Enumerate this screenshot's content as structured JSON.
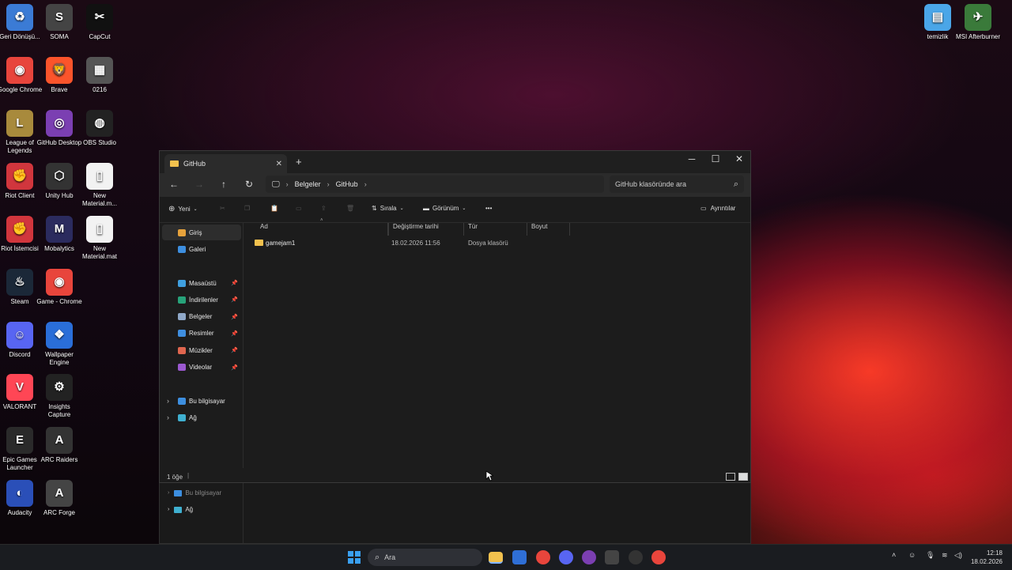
{
  "desktop": {
    "icons": [
      {
        "label": "Geri Dönüşü...",
        "glyph": "♻",
        "color": "#3b7bd5"
      },
      {
        "label": "SOMA",
        "glyph": "S",
        "color": "#444444"
      },
      {
        "label": "CapCut",
        "glyph": "✂",
        "color": "#111111"
      },
      {
        "label": "Google Chrome",
        "glyph": "◉",
        "color": "#e8453c"
      },
      {
        "label": "Brave",
        "glyph": "🦁",
        "color": "#fb542b"
      },
      {
        "label": "0216",
        "glyph": "▦",
        "color": "#555555"
      },
      {
        "label": "League of Legends",
        "glyph": "L",
        "color": "#a88a3c"
      },
      {
        "label": "GitHub Desktop",
        "glyph": "◎",
        "color": "#7b3fb2"
      },
      {
        "label": "OBS Studio",
        "glyph": "◍",
        "color": "#222222"
      },
      {
        "label": "Riot Client",
        "glyph": "✊",
        "color": "#d1363d"
      },
      {
        "label": "Unity Hub",
        "glyph": "⬡",
        "color": "#333333"
      },
      {
        "label": "New Material.m...",
        "glyph": "▯",
        "color": "#f2f2f2"
      },
      {
        "label": "Riot İstemcisi",
        "glyph": "✊",
        "color": "#d1363d"
      },
      {
        "label": "Mobalytics",
        "glyph": "M",
        "color": "#2b2b5e"
      },
      {
        "label": "New Material.mat",
        "glyph": "▯",
        "color": "#f2f2f2"
      },
      {
        "label": "Steam",
        "glyph": "♨",
        "color": "#1b2838"
      },
      {
        "label": "Game - Chrome",
        "glyph": "◉",
        "color": "#e8453c"
      },
      {
        "label": "Discord",
        "glyph": "☺",
        "color": "#5865f2"
      },
      {
        "label": "Wallpaper Engine",
        "glyph": "❖",
        "color": "#2a6ed8"
      },
      {
        "label": "VALORANT",
        "glyph": "V",
        "color": "#ff4655"
      },
      {
        "label": "Insights Capture",
        "glyph": "⚙",
        "color": "#222222"
      },
      {
        "label": "Epic Games Launcher",
        "glyph": "E",
        "color": "#2a2a2a"
      },
      {
        "label": "ARC Raiders",
        "glyph": "A",
        "color": "#333333"
      },
      {
        "label": "Audacity",
        "glyph": "◐",
        "color": "#2a4fb8"
      },
      {
        "label": "ARC Forge",
        "glyph": "A",
        "color": "#444444"
      },
      {
        "label": "temizlik",
        "glyph": "▤",
        "color": "#4aa6e8"
      },
      {
        "label": "MSI Afterburner",
        "glyph": "✈",
        "color": "#3a7a3a"
      }
    ]
  },
  "window": {
    "tab_title": "GitHub",
    "tab_close": "✕",
    "new_tab": "+",
    "minimize": "─",
    "maximize": "☐",
    "close": "✕",
    "nav": {
      "back": "←",
      "forward": "→",
      "up": "↑",
      "refresh": "↻",
      "monitor": "🖵"
    },
    "breadcrumb": [
      "Belgeler",
      "GitHub"
    ],
    "breadcrumb_sep": "›",
    "search_placeholder": "GitHub klasöründe ara",
    "search_icon": "⌕",
    "toolbar": {
      "new_label": "Yeni",
      "sort_label": "Sırala",
      "view_label": "Görünüm",
      "more": "•••",
      "details_label": "Ayrıntılar"
    },
    "sidebar": {
      "top": [
        {
          "label": "Giriş",
          "color": "#e6a23c"
        },
        {
          "label": "Galeri",
          "color": "#3d8fe0"
        }
      ],
      "pinned": [
        {
          "label": "Masaüstü",
          "color": "#3fa0e0"
        },
        {
          "label": "İndirilenler",
          "color": "#27a37a"
        },
        {
          "label": "Belgeler",
          "color": "#8fa8c8"
        },
        {
          "label": "Resimler",
          "color": "#3f8fe0"
        },
        {
          "label": "Müzikler",
          "color": "#e0664f"
        },
        {
          "label": "Videolar",
          "color": "#9b59d0"
        }
      ],
      "pin_glyph": "📌",
      "bottom": [
        {
          "label": "Bu bilgisayar",
          "color": "#3d8fe0"
        },
        {
          "label": "Ağ",
          "color": "#3fb0d0"
        }
      ]
    },
    "columns": [
      "Ad",
      "Değiştirme tarihi",
      "Tür",
      "Boyut"
    ],
    "rows": [
      {
        "name": "gamejam1",
        "date": "18.02.2026 11:56",
        "type": "Dosya klasörü",
        "size": ""
      }
    ],
    "status": "1 öğe"
  },
  "ghost_sidebar": [
    {
      "label": "Bu bilgisayar"
    },
    {
      "label": "Ağ"
    }
  ],
  "taskbar": {
    "search_label": "Ara",
    "time": "12:18",
    "date": "18.02.2026"
  }
}
